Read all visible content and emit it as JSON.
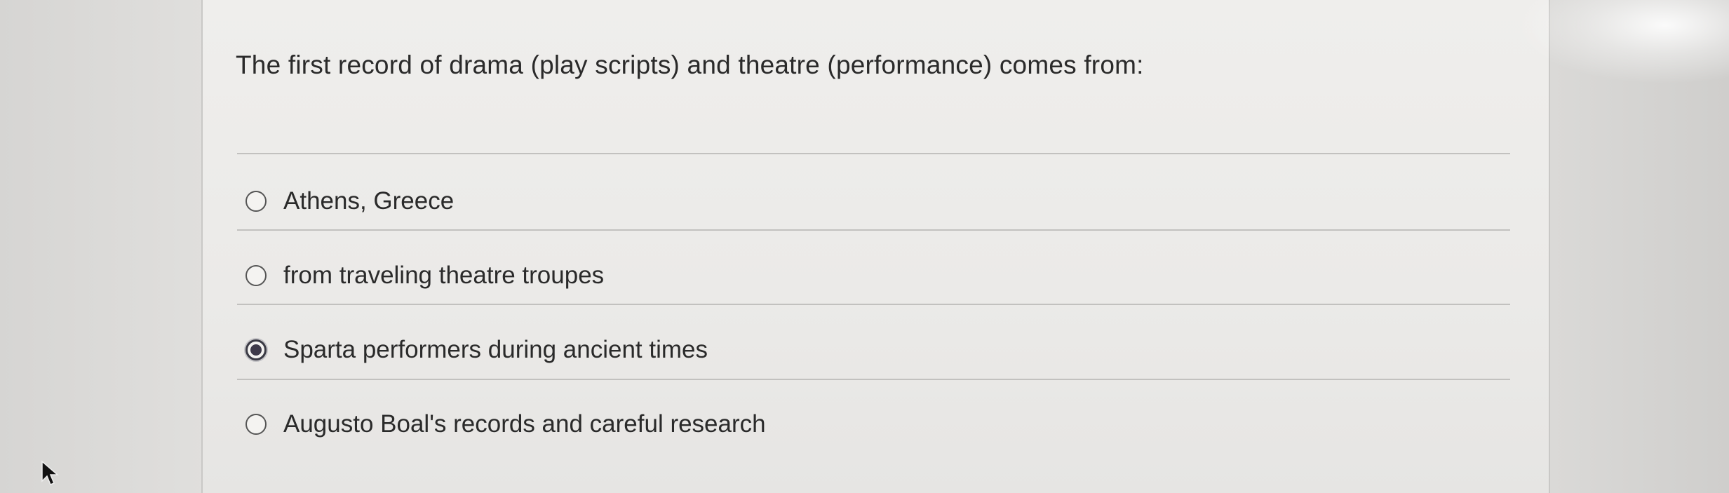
{
  "question": {
    "text": "The first record of drama (play scripts) and theatre (performance) comes from:"
  },
  "options": [
    {
      "label": "Athens, Greece",
      "selected": false
    },
    {
      "label": "from traveling theatre troupes",
      "selected": false
    },
    {
      "label": "Sparta performers during ancient times",
      "selected": true
    },
    {
      "label": "Augusto Boal's records and careful research",
      "selected": false
    }
  ],
  "icons": {
    "cursor": "mouse-pointer-icon",
    "radio": "radio-button-icon"
  },
  "colors": {
    "card_background": "#ebeae8",
    "page_background": "#d9d8d6",
    "text": "#2a2a2a",
    "radio_selected": "#3e3a4a"
  }
}
